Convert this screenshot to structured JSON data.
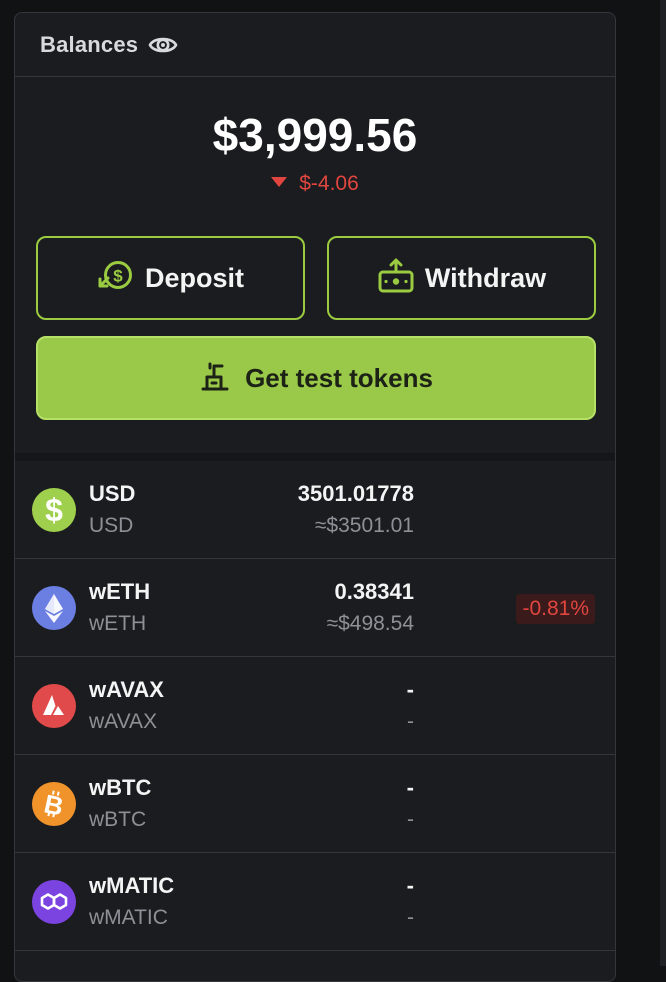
{
  "header": {
    "title": "Balances",
    "icon": "eye-icon"
  },
  "summary": {
    "total": "$3,999.56",
    "change": "$-4.06",
    "change_direction": "down",
    "change_color": "#e0463f"
  },
  "actions": {
    "deposit_label": "Deposit",
    "withdraw_label": "Withdraw",
    "test_tokens_label": "Get test tokens",
    "accent_color": "#9ac94a"
  },
  "assets": [
    {
      "symbol": "USD",
      "name": "USD",
      "amount": "3501.01778",
      "usd_value": "≈$3501.01",
      "change": "",
      "icon": "dollar-coin-icon",
      "color": "#9ed04d"
    },
    {
      "symbol": "wETH",
      "name": "wETH",
      "amount": "0.38341",
      "usd_value": "≈$498.54",
      "change": "-0.81%",
      "icon": "ethereum-icon",
      "color": "#6b7fe3"
    },
    {
      "symbol": "wAVAX",
      "name": "wAVAX",
      "amount": "-",
      "usd_value": "-",
      "change": "",
      "icon": "avalanche-icon",
      "color": "#e04a4a"
    },
    {
      "symbol": "wBTC",
      "name": "wBTC",
      "amount": "-",
      "usd_value": "-",
      "change": "",
      "icon": "bitcoin-icon",
      "color": "#f0932b"
    },
    {
      "symbol": "wMATIC",
      "name": "wMATIC",
      "amount": "-",
      "usd_value": "-",
      "change": "",
      "icon": "polygon-icon",
      "color": "#7b44e0"
    }
  ]
}
